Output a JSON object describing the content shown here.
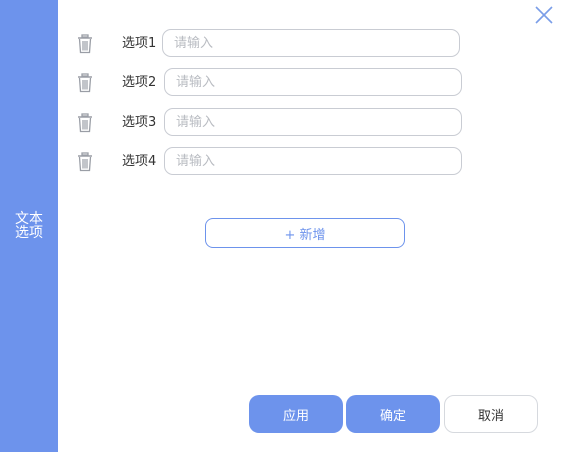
{
  "side_tab": {
    "label": "文本选项"
  },
  "options": [
    {
      "label": "选项1",
      "placeholder": "请输入",
      "value": ""
    },
    {
      "label": "选项2",
      "placeholder": "请输入",
      "value": ""
    },
    {
      "label": "选项3",
      "placeholder": "请输入",
      "value": ""
    },
    {
      "label": "选项4",
      "placeholder": "请输入",
      "value": ""
    }
  ],
  "add_button": {
    "label": "+ 新增"
  },
  "footer": {
    "apply_label": "应用",
    "confirm_label": "确定",
    "cancel_label": "取消"
  },
  "icons": {
    "close": "close-icon",
    "delete": "trash-icon"
  },
  "colors": {
    "accent": "#6d93ec",
    "border": "#c9ccd3",
    "icon_gray": "#9a9ea6"
  }
}
